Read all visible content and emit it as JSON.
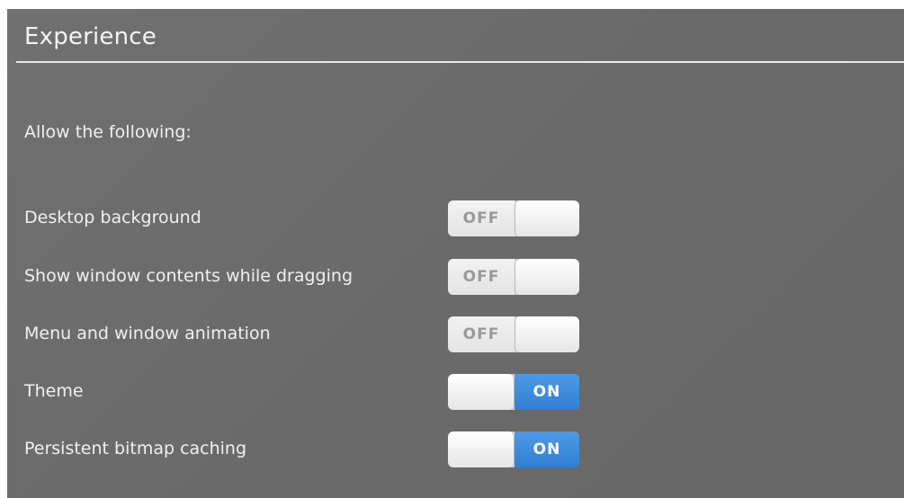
{
  "section": {
    "title": "Experience",
    "subtitle": "Allow the following:"
  },
  "settings": [
    {
      "label": "Desktop background",
      "state": "OFF"
    },
    {
      "label": "Show window contents while dragging",
      "state": "OFF"
    },
    {
      "label": "Menu and window animation",
      "state": "OFF"
    },
    {
      "label": "Theme",
      "state": "ON"
    },
    {
      "label": "Persistent bitmap caching",
      "state": "ON"
    }
  ],
  "colors": {
    "panel_bg": "#6c6c6c",
    "text": "#f0f0f0",
    "on_accent": "#3a8ae0",
    "off_text": "#9a9a9a"
  }
}
